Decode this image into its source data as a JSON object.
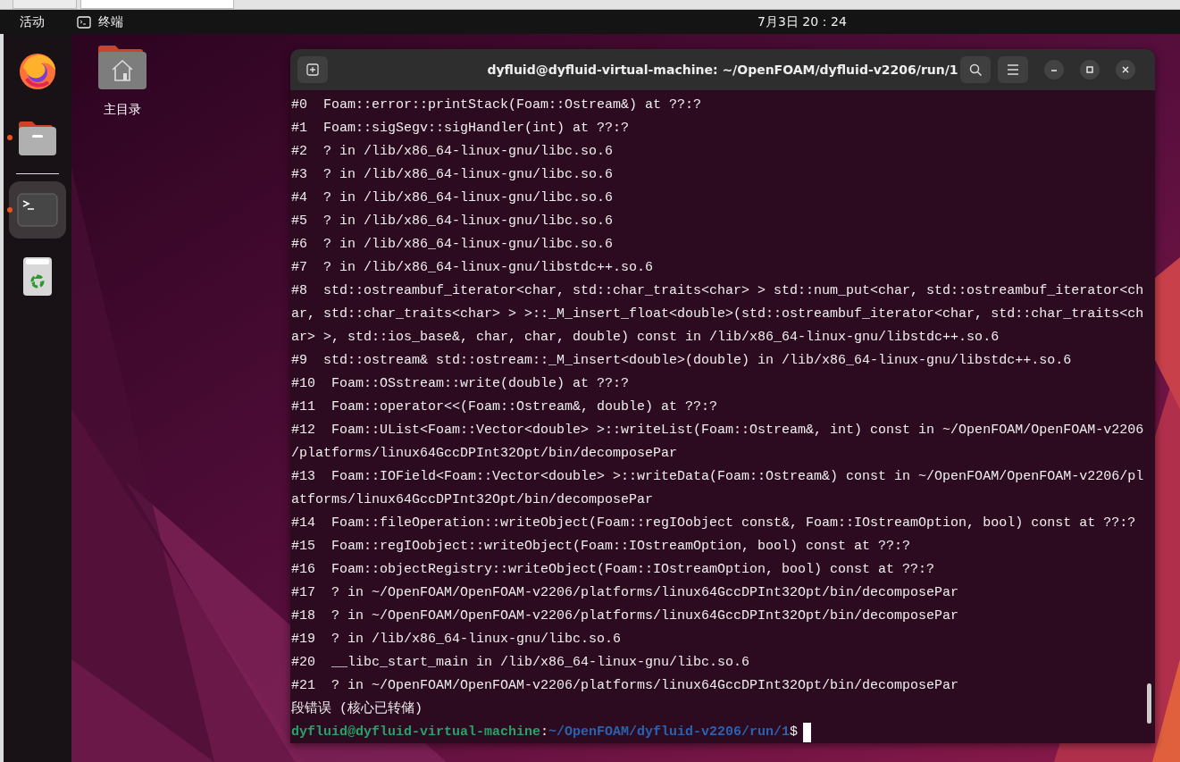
{
  "top_bar": {
    "activities": "活动",
    "app_name": "终端",
    "clock": "7月3日 20：24"
  },
  "dock": {
    "items": [
      {
        "kind": "browser",
        "running": false,
        "selected": false
      },
      {
        "kind": "files",
        "running": true,
        "selected": false
      },
      {
        "kind": "terminal",
        "running": true,
        "selected": true
      },
      {
        "kind": "trash",
        "running": false,
        "selected": false
      }
    ]
  },
  "desktop_icons": [
    {
      "kind": "home",
      "label": "主目录"
    }
  ],
  "terminal": {
    "title": "dyfluid@dyfluid-virtual-machine: ~/OpenFOAM/dyfluid-v2206/run/1",
    "rows": [
      "#0  Foam::error::printStack(Foam::Ostream&) at ??:?",
      "#1  Foam::sigSegv::sigHandler(int) at ??:?",
      "#2  ? in /lib/x86_64-linux-gnu/libc.so.6",
      "#3  ? in /lib/x86_64-linux-gnu/libc.so.6",
      "#4  ? in /lib/x86_64-linux-gnu/libc.so.6",
      "#5  ? in /lib/x86_64-linux-gnu/libc.so.6",
      "#6  ? in /lib/x86_64-linux-gnu/libc.so.6",
      "#7  ? in /lib/x86_64-linux-gnu/libstdc++.so.6",
      "#8  std::ostreambuf_iterator<char, std::char_traits<char> > std::num_put<char, std::ostreambuf_iterator<ch",
      "ar, std::char_traits<char> > >::_M_insert_float<double>(std::ostreambuf_iterator<char, std::char_traits<ch",
      "ar> >, std::ios_base&, char, char, double) const in /lib/x86_64-linux-gnu/libstdc++.so.6",
      "#9  std::ostream& std::ostream::_M_insert<double>(double) in /lib/x86_64-linux-gnu/libstdc++.so.6",
      "#10  Foam::OSstream::write(double) at ??:?",
      "#11  Foam::operator<<(Foam::Ostream&, double) at ??:?",
      "#12  Foam::UList<Foam::Vector<double> >::writeList(Foam::Ostream&, int) const in ~/OpenFOAM/OpenFOAM-v2206",
      "/platforms/linux64GccDPInt32Opt/bin/decomposePar",
      "#13  Foam::IOField<Foam::Vector<double> >::writeData(Foam::Ostream&) const in ~/OpenFOAM/OpenFOAM-v2206/pl",
      "atforms/linux64GccDPInt32Opt/bin/decomposePar",
      "#14  Foam::fileOperation::writeObject(Foam::regIOobject const&, Foam::IOstreamOption, bool) const at ??:?",
      "#15  Foam::regIOobject::writeObject(Foam::IOstreamOption, bool) const at ??:?",
      "#16  Foam::objectRegistry::writeObject(Foam::IOstreamOption, bool) const at ??:?",
      "#17  ? in ~/OpenFOAM/OpenFOAM-v2206/platforms/linux64GccDPInt32Opt/bin/decomposePar",
      "#18  ? in ~/OpenFOAM/OpenFOAM-v2206/platforms/linux64GccDPInt32Opt/bin/decomposePar",
      "#19  ? in /lib/x86_64-linux-gnu/libc.so.6",
      "#20  __libc_start_main in /lib/x86_64-linux-gnu/libc.so.6",
      "#21  ? in ~/OpenFOAM/OpenFOAM-v2206/platforms/linux64GccDPInt32Opt/bin/decomposePar",
      "段错误 (核心已转储)"
    ],
    "prompt": {
      "user_host": "dyfluid@dyfluid-virtual-machine",
      "separator": ":",
      "path": "~/OpenFOAM/dyfluid-v2206/run/1",
      "symbol": "$"
    }
  }
}
